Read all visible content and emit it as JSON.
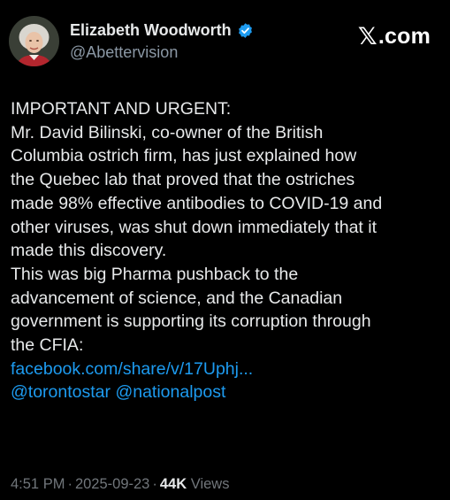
{
  "author": {
    "name": "Elizabeth Woodworth",
    "handle": "@Abettervision",
    "verified": true
  },
  "brand": {
    "x_glyph": "𝕏",
    "suffix": ".com"
  },
  "tweet": {
    "lines": [
      "IMPORTANT AND URGENT:",
      "Mr. David Bilinski, co-owner of the British",
      "Columbia ostrich firm, has just explained how",
      "the Quebec lab that proved that the ostriches",
      "made 98% effective antibodies to COVID-19 and",
      "other viruses, was shut down immediately that it",
      "made this discovery.",
      "This was big Pharma pushback to the",
      "advancement of science, and the Canadian",
      "government is supporting its corruption through",
      "the CFIA:"
    ],
    "link_url": "facebook.com/share/v/17Uphj...",
    "mention_1": "@torontostar",
    "mention_2": "@nationalpost"
  },
  "meta": {
    "time": "4:51 PM",
    "date": "2025-09-23",
    "separator": "·",
    "views_count": "44K",
    "views_label": "Views"
  },
  "colors": {
    "background": "#000000",
    "text": "#e7e9ea",
    "muted": "#71767b",
    "link": "#1d9bf0",
    "verified": "#1d9bf0"
  },
  "icons": {
    "verified": "verified-badge-icon",
    "brand": "x-logo-icon"
  }
}
